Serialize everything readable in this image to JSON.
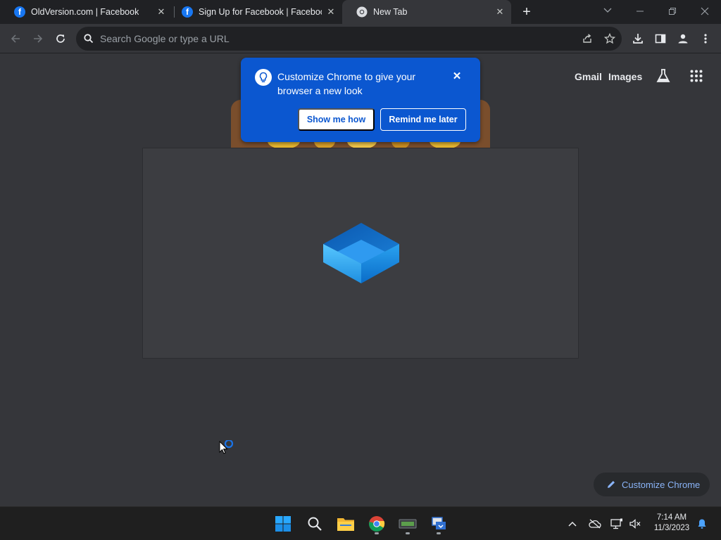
{
  "tabs": [
    {
      "title": "OldVersion.com | Facebook",
      "icon": "facebook-icon",
      "active": false
    },
    {
      "title": "Sign Up for Facebook | Facebook",
      "icon": "facebook-icon",
      "active": false
    },
    {
      "title": "New Tab",
      "icon": "chrome-icon",
      "active": true
    }
  ],
  "toolbar": {
    "omnibox_placeholder": "Search Google or type a URL"
  },
  "ntp": {
    "gmail_link": "Gmail",
    "images_link": "Images",
    "customize_button": "Customize Chrome"
  },
  "callout": {
    "message": "Customize Chrome to give your browser a new look",
    "primary_button": "Show me how",
    "secondary_button": "Remind me later"
  },
  "taskbar": {
    "time": "7:14 AM",
    "date": "11/3/2023",
    "pinned": [
      "windows-start",
      "search",
      "file-explorer",
      "google-chrome",
      "app-window",
      "app-installer"
    ]
  },
  "colors": {
    "frame": "#202124",
    "toolbar": "#35363a",
    "callout": "#0b57d0",
    "accent_link": "#8ab4f8",
    "taskbar": "#1f1f1f"
  }
}
